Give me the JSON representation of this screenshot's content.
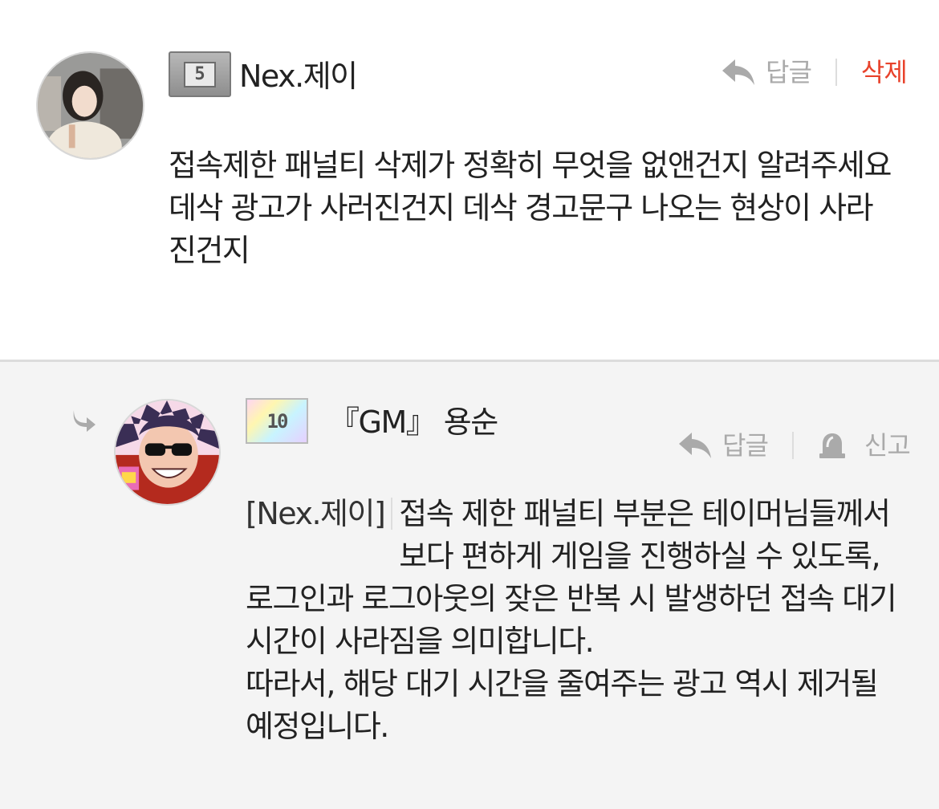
{
  "comments": [
    {
      "nickname": "Nex.제이",
      "level": "5",
      "reply_label": "답글",
      "delete_label": "삭제",
      "content": "접속제한 패널티 삭제가 정확히 무엇을 없앤건지 알려주세요\n데삭 광고가 사러진건지 데삭 경고문구 나오는 현상이 사라진건지"
    },
    {
      "nickname": "『GM』 용순",
      "level": "10",
      "reply_label": "답글",
      "report_label": "신고",
      "mention": "[Nex.제이]",
      "mention_body": "접속 제한 패널티 부분은 테이머님들께서 보다 편하게 게임을 진행하실 수 있도록,",
      "content": "로그인과 로그아웃의 잦은 반복 시 발생하던 접속 대기 시간이 사라짐을 의미합니다.\n따라서, 해당 대기 시간을 줄여주는 광고 역시 제거될 예정입니다."
    }
  ],
  "icons": {
    "reply": "reply-arrow-icon",
    "report": "siren-icon",
    "nested": "nested-reply-icon"
  },
  "colors": {
    "delete": "#e8422b",
    "muted": "#aaaaaa",
    "reply_bg": "#f4f4f4"
  }
}
